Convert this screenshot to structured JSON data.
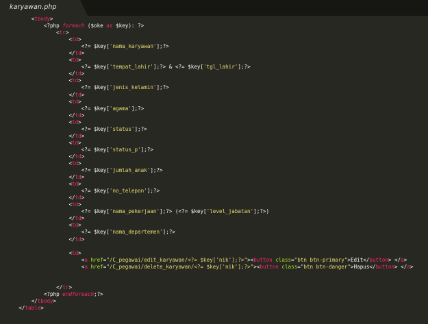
{
  "tab": {
    "filename": "karyawan.php"
  },
  "colors": {
    "background": "#272822",
    "tabbar": "#161712",
    "tag": "#f92672",
    "string": "#e6db74",
    "attribute": "#a6e22e",
    "text": "#f8f8f2"
  },
  "code_lines": [
    {
      "indent": "        ",
      "tokens": [
        {
          "t": "<",
          "c": "punc"
        },
        {
          "t": "tbody",
          "c": "tag"
        },
        {
          "t": ">",
          "c": "punc"
        }
      ]
    },
    {
      "indent": "            ",
      "tokens": [
        {
          "t": "<?php",
          "c": "php"
        },
        {
          "t": " foreach",
          "c": "kw"
        },
        {
          "t": " ($oke ",
          "c": "text"
        },
        {
          "t": "as",
          "c": "kw"
        },
        {
          "t": " $key): ?>",
          "c": "text"
        }
      ]
    },
    {
      "indent": "                ",
      "tokens": [
        {
          "t": "<",
          "c": "punc"
        },
        {
          "t": "tr",
          "c": "tag"
        },
        {
          "t": ">",
          "c": "punc"
        }
      ]
    },
    {
      "indent": "                    ",
      "tokens": [
        {
          "t": "<",
          "c": "punc"
        },
        {
          "t": "td",
          "c": "tag"
        },
        {
          "t": ">",
          "c": "punc"
        }
      ]
    },
    {
      "indent": "                        ",
      "tokens": [
        {
          "t": "<?= $key[",
          "c": "text"
        },
        {
          "t": "'nama_karyawan'",
          "c": "str"
        },
        {
          "t": "];?>",
          "c": "text"
        }
      ]
    },
    {
      "indent": "                    ",
      "tokens": [
        {
          "t": "</",
          "c": "punc"
        },
        {
          "t": "td",
          "c": "tag"
        },
        {
          "t": ">",
          "c": "punc"
        }
      ]
    },
    {
      "indent": "                    ",
      "tokens": [
        {
          "t": "<",
          "c": "punc"
        },
        {
          "t": "td",
          "c": "tag"
        },
        {
          "t": ">",
          "c": "punc"
        }
      ]
    },
    {
      "indent": "                        ",
      "tokens": [
        {
          "t": "<?= $key[",
          "c": "text"
        },
        {
          "t": "'tempat_lahir'",
          "c": "str"
        },
        {
          "t": "];?> & <?= $key[",
          "c": "text"
        },
        {
          "t": "'tgl_lahir'",
          "c": "str"
        },
        {
          "t": "];?>",
          "c": "text"
        }
      ]
    },
    {
      "indent": "                    ",
      "tokens": [
        {
          "t": "</",
          "c": "punc"
        },
        {
          "t": "td",
          "c": "tag"
        },
        {
          "t": ">",
          "c": "punc"
        }
      ]
    },
    {
      "indent": "                    ",
      "tokens": [
        {
          "t": "<",
          "c": "punc"
        },
        {
          "t": "td",
          "c": "tag"
        },
        {
          "t": ">",
          "c": "punc"
        }
      ]
    },
    {
      "indent": "                        ",
      "tokens": [
        {
          "t": "<?= $key[",
          "c": "text"
        },
        {
          "t": "'jenis_kelamin'",
          "c": "str"
        },
        {
          "t": "];?>",
          "c": "text"
        }
      ]
    },
    {
      "indent": "                    ",
      "tokens": [
        {
          "t": "</",
          "c": "punc"
        },
        {
          "t": "td",
          "c": "tag"
        },
        {
          "t": ">",
          "c": "punc"
        }
      ]
    },
    {
      "indent": "                    ",
      "tokens": [
        {
          "t": "<",
          "c": "punc"
        },
        {
          "t": "td",
          "c": "tag"
        },
        {
          "t": ">",
          "c": "punc"
        }
      ]
    },
    {
      "indent": "                        ",
      "tokens": [
        {
          "t": "<?= $key[",
          "c": "text"
        },
        {
          "t": "'agama'",
          "c": "str"
        },
        {
          "t": "];?>",
          "c": "text"
        }
      ]
    },
    {
      "indent": "                    ",
      "tokens": [
        {
          "t": "</",
          "c": "punc"
        },
        {
          "t": "td",
          "c": "tag"
        },
        {
          "t": ">",
          "c": "punc"
        }
      ]
    },
    {
      "indent": "                    ",
      "tokens": [
        {
          "t": "<",
          "c": "punc"
        },
        {
          "t": "td",
          "c": "tag"
        },
        {
          "t": ">",
          "c": "punc"
        }
      ]
    },
    {
      "indent": "                        ",
      "tokens": [
        {
          "t": "<?= $key[",
          "c": "text"
        },
        {
          "t": "'status'",
          "c": "str"
        },
        {
          "t": "];?>",
          "c": "text"
        }
      ]
    },
    {
      "indent": "                    ",
      "tokens": [
        {
          "t": "</",
          "c": "punc"
        },
        {
          "t": "td",
          "c": "tag"
        },
        {
          "t": ">",
          "c": "punc"
        }
      ]
    },
    {
      "indent": "                    ",
      "tokens": [
        {
          "t": "<",
          "c": "punc"
        },
        {
          "t": "td",
          "c": "tag"
        },
        {
          "t": ">",
          "c": "punc"
        }
      ]
    },
    {
      "indent": "                        ",
      "tokens": [
        {
          "t": "<?= $key[",
          "c": "text"
        },
        {
          "t": "'status_p'",
          "c": "str"
        },
        {
          "t": "];?>",
          "c": "text"
        }
      ]
    },
    {
      "indent": "                    ",
      "tokens": [
        {
          "t": "</",
          "c": "punc"
        },
        {
          "t": "td",
          "c": "tag"
        },
        {
          "t": ">",
          "c": "punc"
        }
      ]
    },
    {
      "indent": "                    ",
      "tokens": [
        {
          "t": "<",
          "c": "punc"
        },
        {
          "t": "td",
          "c": "tag"
        },
        {
          "t": ">",
          "c": "punc"
        }
      ]
    },
    {
      "indent": "                        ",
      "tokens": [
        {
          "t": "<?= $key[",
          "c": "text"
        },
        {
          "t": "'jumlah_anak'",
          "c": "str"
        },
        {
          "t": "];?>",
          "c": "text"
        }
      ]
    },
    {
      "indent": "                    ",
      "tokens": [
        {
          "t": "</",
          "c": "punc"
        },
        {
          "t": "td",
          "c": "tag"
        },
        {
          "t": ">",
          "c": "punc"
        }
      ]
    },
    {
      "indent": "                    ",
      "tokens": [
        {
          "t": "<",
          "c": "punc"
        },
        {
          "t": "td",
          "c": "tag"
        },
        {
          "t": ">",
          "c": "punc"
        }
      ]
    },
    {
      "indent": "                        ",
      "tokens": [
        {
          "t": "<?= $key[",
          "c": "text"
        },
        {
          "t": "'no_telepon'",
          "c": "str"
        },
        {
          "t": "];?>",
          "c": "text"
        }
      ]
    },
    {
      "indent": "                    ",
      "tokens": [
        {
          "t": "</",
          "c": "punc"
        },
        {
          "t": "td",
          "c": "tag"
        },
        {
          "t": ">",
          "c": "punc"
        }
      ]
    },
    {
      "indent": "                    ",
      "tokens": [
        {
          "t": "<",
          "c": "punc"
        },
        {
          "t": "td",
          "c": "tag"
        },
        {
          "t": ">",
          "c": "punc"
        }
      ]
    },
    {
      "indent": "                        ",
      "tokens": [
        {
          "t": "<?= $key[",
          "c": "text"
        },
        {
          "t": "'nama_pekerjaan'",
          "c": "str"
        },
        {
          "t": "];?> (<?= $key[",
          "c": "text"
        },
        {
          "t": "'level_jabatan'",
          "c": "str"
        },
        {
          "t": "];?>)",
          "c": "text"
        }
      ]
    },
    {
      "indent": "                    ",
      "tokens": [
        {
          "t": "</",
          "c": "punc"
        },
        {
          "t": "td",
          "c": "tag"
        },
        {
          "t": ">",
          "c": "punc"
        }
      ]
    },
    {
      "indent": "                    ",
      "tokens": [
        {
          "t": "<",
          "c": "punc"
        },
        {
          "t": "td",
          "c": "tag"
        },
        {
          "t": ">",
          "c": "punc"
        }
      ]
    },
    {
      "indent": "                        ",
      "tokens": [
        {
          "t": "<?= $key[",
          "c": "text"
        },
        {
          "t": "'nama_departemen'",
          "c": "str"
        },
        {
          "t": "];?>",
          "c": "text"
        }
      ]
    },
    {
      "indent": "                    ",
      "tokens": [
        {
          "t": "</",
          "c": "punc"
        },
        {
          "t": "td",
          "c": "tag"
        },
        {
          "t": ">",
          "c": "punc"
        }
      ]
    },
    {
      "indent": "",
      "tokens": []
    },
    {
      "indent": "                    ",
      "tokens": [
        {
          "t": "<",
          "c": "punc"
        },
        {
          "t": "td",
          "c": "tag"
        },
        {
          "t": ">",
          "c": "punc"
        }
      ]
    },
    {
      "indent": "                        ",
      "tokens": [
        {
          "t": "<",
          "c": "punc"
        },
        {
          "t": "a",
          "c": "tag"
        },
        {
          "t": " href",
          "c": "attr"
        },
        {
          "t": "=",
          "c": "op"
        },
        {
          "t": "\"/C_pegawai/edit_karyawan/<?= $key['nik'];?>\"",
          "c": "str"
        },
        {
          "t": "><",
          "c": "punc"
        },
        {
          "t": "button",
          "c": "tag"
        },
        {
          "t": " class",
          "c": "attr"
        },
        {
          "t": "=",
          "c": "op"
        },
        {
          "t": "\"btn btn-primary\"",
          "c": "str"
        },
        {
          "t": ">Edit</",
          "c": "text"
        },
        {
          "t": "button",
          "c": "tag"
        },
        {
          "t": "> </",
          "c": "punc"
        },
        {
          "t": "a",
          "c": "tag"
        },
        {
          "t": ">",
          "c": "punc"
        }
      ]
    },
    {
      "indent": "                        ",
      "tokens": [
        {
          "t": "<",
          "c": "punc"
        },
        {
          "t": "a",
          "c": "tag"
        },
        {
          "t": " href",
          "c": "attr"
        },
        {
          "t": "=",
          "c": "op"
        },
        {
          "t": "\"/C_pegawai/delete_karyawan/<?= $key['nik'];?>\"",
          "c": "str"
        },
        {
          "t": "><",
          "c": "punc"
        },
        {
          "t": "button",
          "c": "tag"
        },
        {
          "t": " class",
          "c": "attr"
        },
        {
          "t": "=",
          "c": "op"
        },
        {
          "t": "\"btn btn-danger\"",
          "c": "str"
        },
        {
          "t": ">Hapus</",
          "c": "text"
        },
        {
          "t": "button",
          "c": "tag"
        },
        {
          "t": "> </",
          "c": "punc"
        },
        {
          "t": "a",
          "c": "tag"
        },
        {
          "t": ">",
          "c": "punc"
        }
      ]
    },
    {
      "indent": "",
      "tokens": []
    },
    {
      "indent": "",
      "tokens": []
    },
    {
      "indent": "                ",
      "tokens": [
        {
          "t": "</",
          "c": "punc"
        },
        {
          "t": "tr",
          "c": "tag"
        },
        {
          "t": ">",
          "c": "punc"
        }
      ]
    },
    {
      "indent": "            ",
      "tokens": [
        {
          "t": "<?php",
          "c": "php"
        },
        {
          "t": " endforeach",
          "c": "kw"
        },
        {
          "t": ";?>",
          "c": "text"
        }
      ]
    },
    {
      "indent": "        ",
      "tokens": [
        {
          "t": "</",
          "c": "punc"
        },
        {
          "t": "tbody",
          "c": "tag"
        },
        {
          "t": ">",
          "c": "punc"
        }
      ]
    },
    {
      "indent": "    ",
      "tokens": [
        {
          "t": "</",
          "c": "punc"
        },
        {
          "t": "table",
          "c": "tag"
        },
        {
          "t": ">",
          "c": "punc"
        }
      ]
    }
  ]
}
